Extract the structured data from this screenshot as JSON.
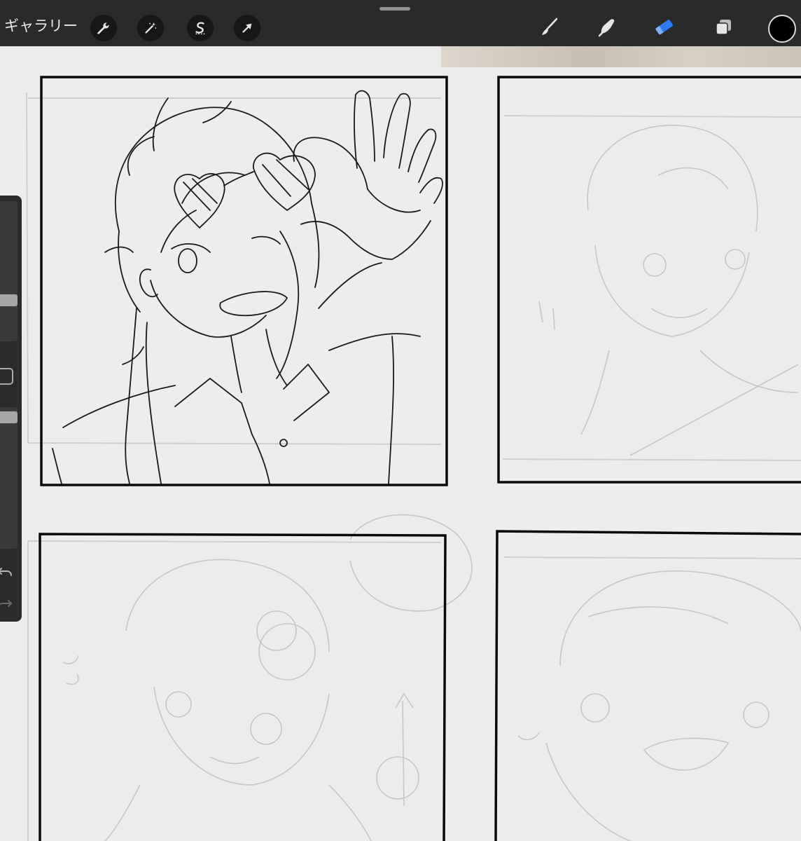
{
  "app": {
    "name": "Procreate"
  },
  "topbar": {
    "gallery_label": "ギャラリー",
    "left_tools": [
      {
        "name": "actions",
        "icon": "wrench-icon"
      },
      {
        "name": "adjustments",
        "icon": "magic-wand-icon"
      },
      {
        "name": "selection",
        "icon": "selection-s-icon"
      },
      {
        "name": "transform",
        "icon": "arrow-cursor-icon"
      }
    ],
    "right_tools": [
      {
        "name": "brush",
        "icon": "brush-icon",
        "active": false
      },
      {
        "name": "smudge",
        "icon": "smudge-icon",
        "active": false
      },
      {
        "name": "eraser",
        "icon": "eraser-icon",
        "active": true
      },
      {
        "name": "layers",
        "icon": "layers-icon",
        "active": false
      }
    ],
    "current_color": "#000000",
    "active_tool_color": "#2e7bf6"
  },
  "sidebar": {
    "brush_size": 0.5,
    "opacity": 0.8,
    "buttons": [
      "modify-button",
      "undo-icon",
      "redo-icon"
    ]
  },
  "canvas": {
    "panels": [
      {
        "name": "panel-top-left",
        "state": "inked"
      },
      {
        "name": "panel-top-right",
        "state": "sketch"
      },
      {
        "name": "panel-bottom-left",
        "state": "sketch"
      },
      {
        "name": "panel-bottom-right",
        "state": "sketch"
      }
    ]
  }
}
